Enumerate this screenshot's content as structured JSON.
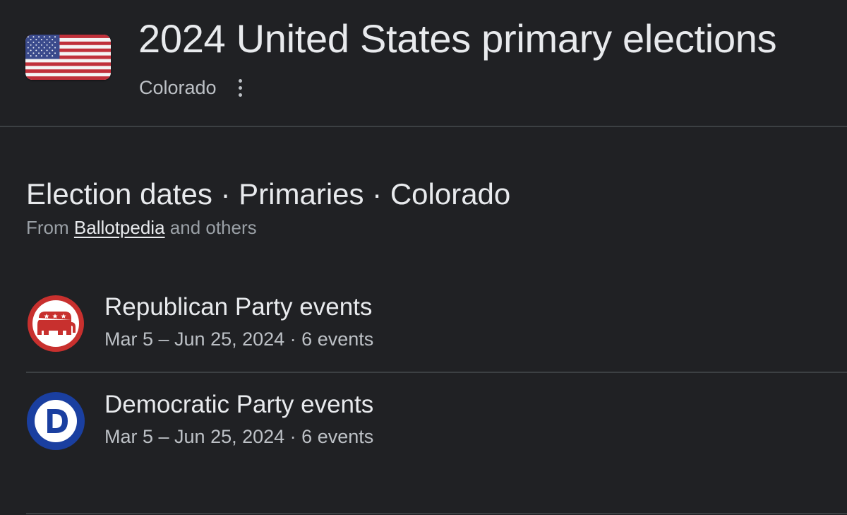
{
  "header": {
    "title": "2024 United States primary elections",
    "subtitle": "Colorado",
    "flag_icon": "us-flag-icon",
    "more_icon": "more-vert-icon"
  },
  "section": {
    "title": "Election dates · Primaries · Colorado",
    "source_prefix": "From ",
    "source_link": "Ballotpedia",
    "source_suffix": " and others"
  },
  "parties": [
    {
      "name": "Republican Party events",
      "dates": "Mar 5 – Jun 25, 2024",
      "separator": " · ",
      "count": "6 events",
      "icon": "republican-elephant-icon",
      "color": "#c8302e"
    },
    {
      "name": "Democratic Party events",
      "dates": "Mar 5 – Jun 25, 2024",
      "separator": " · ",
      "count": "6 events",
      "icon": "democratic-d-icon",
      "color": "#1a3fa0"
    }
  ],
  "colors": {
    "background": "#202124",
    "text_primary": "#e8eaed",
    "text_secondary": "#bdc1c6",
    "divider": "#3c4043"
  }
}
